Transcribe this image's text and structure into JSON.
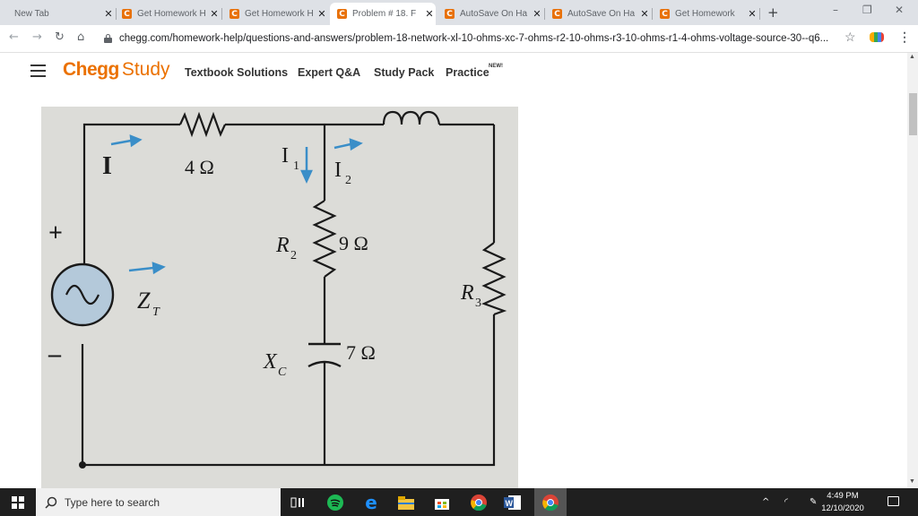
{
  "tabs": [
    {
      "title": "New Tab",
      "favicon": "",
      "active": false
    },
    {
      "title": "Get Homework H",
      "favicon": "C",
      "active": false
    },
    {
      "title": "Get Homework H",
      "favicon": "C",
      "active": false
    },
    {
      "title": "Problem # 18. F",
      "favicon": "C",
      "active": true
    },
    {
      "title": "AutoSave On Ha",
      "favicon": "C",
      "active": false
    },
    {
      "title": "AutoSave On Ha",
      "favicon": "C",
      "active": false
    },
    {
      "title": "Get Homework",
      "favicon": "C",
      "active": false
    }
  ],
  "toolbar": {
    "url": "chegg.com/homework-help/questions-and-answers/problem-18-network-xl-10-ohms-xc-7-ohms-r2-10-ohms-r3-10-ohms-r1-4-ohms-voltage-source-30--q6..."
  },
  "site": {
    "brand_bold": "Chegg",
    "brand_light": "Study",
    "nav": [
      "Textbook Solutions",
      "Expert Q&A",
      "Study Pack",
      "Practice"
    ],
    "badge": "NEW!"
  },
  "circuit": {
    "labels": {
      "I": "I",
      "r1": "4 Ω",
      "i1": "I",
      "i1_sub": "1",
      "i2": "I",
      "i2_sub": "2",
      "r2": "R",
      "r2_sub": "2",
      "r2_val": "9 Ω",
      "zt": "Z",
      "zt_sub": "T",
      "r3": "R",
      "r3_sub": "3",
      "xc": "X",
      "xc_sub": "C",
      "xc_val": "7 Ω",
      "plus": "+",
      "minus": "–"
    },
    "colors": {
      "paper": "#dcdcd8",
      "wire": "#1a1a1a",
      "arrow": "#3a8ec8",
      "source": "#b4c9da"
    }
  },
  "taskbar": {
    "search_placeholder": "Type here to search",
    "time": "4:49 PM",
    "date": "12/10/2020"
  }
}
